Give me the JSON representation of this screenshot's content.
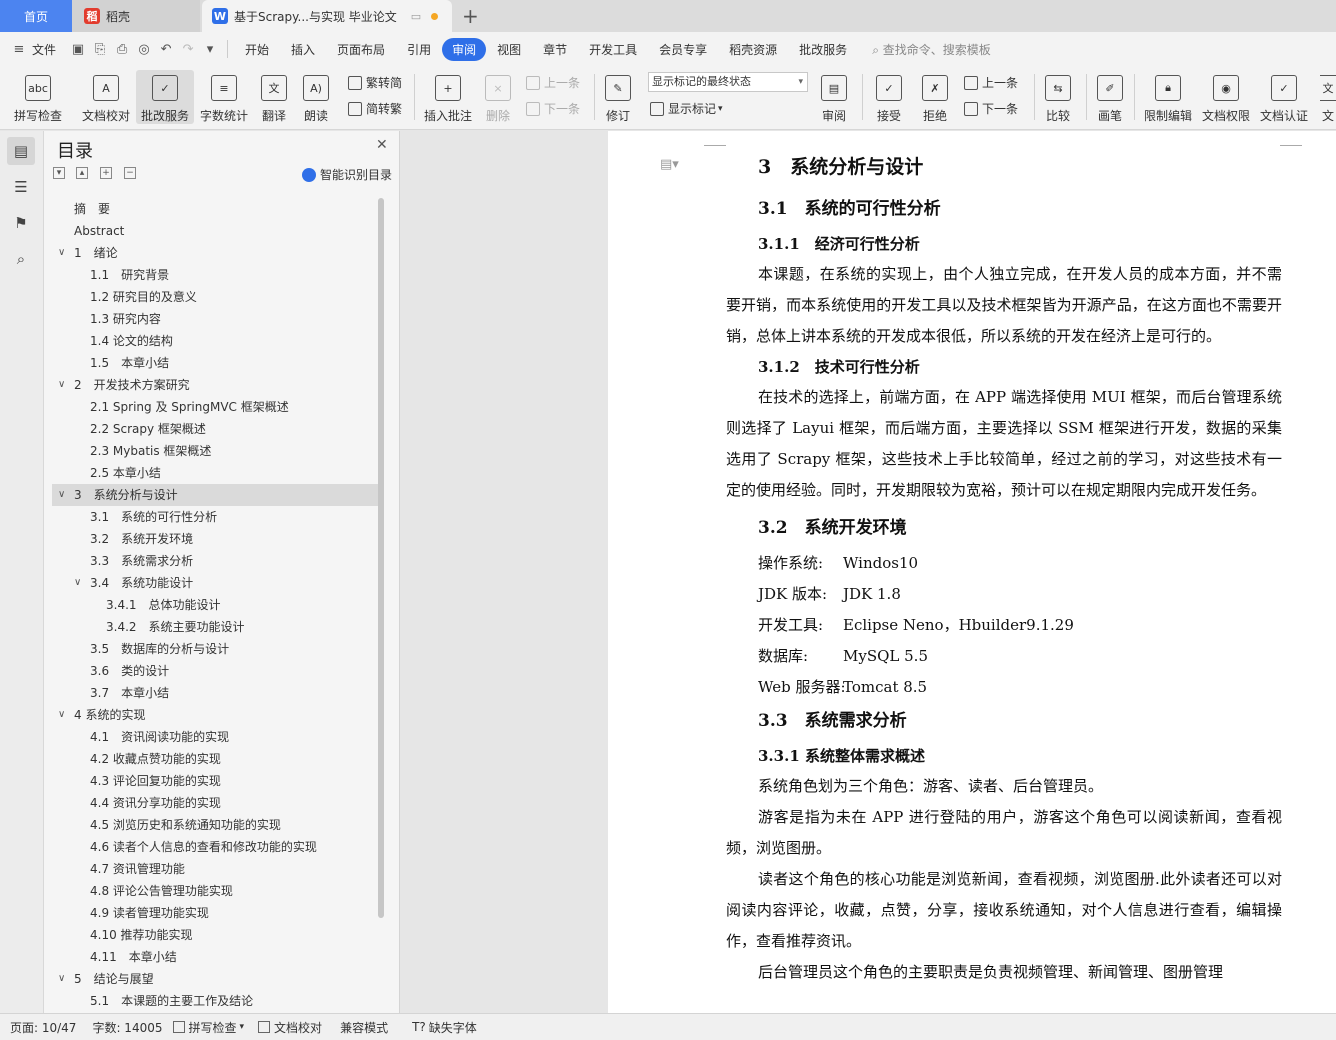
{
  "tabs": {
    "home": "首页",
    "daoke": "稻壳",
    "doc": "基于Scrapy...与实现 毕业论文"
  },
  "menu": [
    "文件",
    "开始",
    "插入",
    "页面布局",
    "引用",
    "审阅",
    "视图",
    "章节",
    "开发工具",
    "会员专享",
    "稻壳资源",
    "批改服务"
  ],
  "menu_active": "审阅",
  "menu_search": "查找命令、搜索模板",
  "ribbon": {
    "spell": "拼写检查",
    "proof": "文档校对",
    "correct": "批改服务",
    "wordcount": "字数统计",
    "translate": "翻译",
    "read": "朗读",
    "s2t": "繁转简",
    "t2s": "简转繁",
    "insert_comment": "插入批注",
    "delete": "删除",
    "prev_comment": "上一条",
    "next_comment": "下一条",
    "revise": "修订",
    "markup_state": "显示标记的最终状态",
    "show_markup": "显示标记",
    "review": "审阅",
    "accept": "接受",
    "reject": "拒绝",
    "prev_change": "上一条",
    "next_change": "下一条",
    "compare": "比较",
    "pen": "画笔",
    "restrict": "限制编辑",
    "permission": "文档权限",
    "certify": "文档认证",
    "more": "文"
  },
  "toc": {
    "title": "目录",
    "smart": "智能识别目录",
    "items": [
      {
        "text": "摘　要",
        "level": 0,
        "indent": 22
      },
      {
        "text": "Abstract",
        "level": 0,
        "indent": 22
      },
      {
        "text": "1　绪论",
        "level": 1,
        "indent": 22,
        "chev": true
      },
      {
        "text": "1.1　研究背景",
        "level": 2,
        "indent": 38
      },
      {
        "text": "1.2  研究目的及意义",
        "level": 2,
        "indent": 38
      },
      {
        "text": "1.3  研究内容",
        "level": 2,
        "indent": 38
      },
      {
        "text": "1.4  论文的结构",
        "level": 2,
        "indent": 38
      },
      {
        "text": "1.5　本章小结",
        "level": 2,
        "indent": 38
      },
      {
        "text": "2　开发技术方案研究",
        "level": 1,
        "indent": 22,
        "chev": true
      },
      {
        "text": "2.1 Spring 及 SpringMVC 框架概述",
        "level": 2,
        "indent": 38
      },
      {
        "text": "2.2 Scrapy 框架概述",
        "level": 2,
        "indent": 38
      },
      {
        "text": "2.3 Mybatis 框架概述",
        "level": 2,
        "indent": 38
      },
      {
        "text": "2.5  本章小结",
        "level": 2,
        "indent": 38
      },
      {
        "text": "3　系统分析与设计",
        "level": 1,
        "indent": 22,
        "chev": true,
        "selected": true
      },
      {
        "text": "3.1　系统的可行性分析",
        "level": 2,
        "indent": 38
      },
      {
        "text": "3.2　系统开发环境",
        "level": 2,
        "indent": 38
      },
      {
        "text": "3.3　系统需求分析",
        "level": 2,
        "indent": 38
      },
      {
        "text": "3.4　系统功能设计",
        "level": 2,
        "indent": 38,
        "chev": true
      },
      {
        "text": "3.4.1　总体功能设计",
        "level": 3,
        "indent": 54
      },
      {
        "text": "3.4.2　系统主要功能设计",
        "level": 3,
        "indent": 54
      },
      {
        "text": "3.5　数据库的分析与设计",
        "level": 2,
        "indent": 38
      },
      {
        "text": "3.6　类的设计",
        "level": 2,
        "indent": 38
      },
      {
        "text": "3.7　本章小结",
        "level": 2,
        "indent": 38
      },
      {
        "text": "4  系统的实现",
        "level": 1,
        "indent": 22,
        "chev": true
      },
      {
        "text": "4.1　资讯阅读功能的实现",
        "level": 2,
        "indent": 38
      },
      {
        "text": "4.2 收藏点赞功能的实现",
        "level": 2,
        "indent": 38
      },
      {
        "text": "4.3 评论回复功能的实现",
        "level": 2,
        "indent": 38
      },
      {
        "text": "4.4 资讯分享功能的实现",
        "level": 2,
        "indent": 38
      },
      {
        "text": "4.5 浏览历史和系统通知功能的实现",
        "level": 2,
        "indent": 38
      },
      {
        "text": "4.6 读者个人信息的查看和修改功能的实现",
        "level": 2,
        "indent": 38
      },
      {
        "text": "4.7 资讯管理功能",
        "level": 2,
        "indent": 38
      },
      {
        "text": "4.8 评论公告管理功能实现",
        "level": 2,
        "indent": 38
      },
      {
        "text": "4.9 读者管理功能实现",
        "level": 2,
        "indent": 38
      },
      {
        "text": "4.10 推荐功能实现",
        "level": 2,
        "indent": 38
      },
      {
        "text": "4.11　本章小结",
        "level": 2,
        "indent": 38
      },
      {
        "text": "5　结论与展望",
        "level": 1,
        "indent": 22,
        "chev": true
      },
      {
        "text": "5.1　本课题的主要工作及结论",
        "level": 2,
        "indent": 38
      }
    ]
  },
  "doc": {
    "h_3": "3　系统分析与设计",
    "h_3_1": "3.1　系统的可行性分析",
    "h_3_1_1": "3.1.1　经济可行性分析",
    "p_economic": "本课题，在系统的实现上，由个人独立完成，在开发人员的成本方面，并不需要开销，而本系统使用的开发工具以及技术框架皆为开源产品，在这方面也不需要开销，总体上讲本系统的开发成本很低，所以系统的开发在经济上是可行的。",
    "h_3_1_2": "3.1.2　技术可行性分析",
    "p_technical": "在技术的选择上，前端方面，在 APP 端选择使用 MUI 框架，而后台管理系统则选择了 Layui 框架，而后端方面，主要选择以 SSM 框架进行开发，数据的采集选用了 Scrapy 框架，这些技术上手比较简单，经过之前的学习，对这些技术有一定的使用经验。同时，开发期限较为宽裕，预计可以在规定期限内完成开发任务。",
    "h_3_2": "3.2　系统开发环境",
    "env": [
      {
        "k": "操作系统:",
        "v": "Windos10"
      },
      {
        "k": "JDK 版本:",
        "v": "JDK 1.8"
      },
      {
        "k": "开发工具:",
        "v": "Eclipse Neno，Hbuilder9.1.29"
      },
      {
        "k": "数据库:",
        "v": "MySQL 5.5"
      },
      {
        "k": "Web 服务器:",
        "v": "Tomcat 8.5"
      }
    ],
    "h_3_3": "3.3　系统需求分析",
    "h_3_3_1": "3.3.1  系统整体需求概述",
    "p_roles": "系统角色划为三个角色：游客、读者、后台管理员。",
    "p_guest": "游客是指为未在 APP 进行登陆的用户，游客这个角色可以阅读新闻，查看视频，浏览图册。",
    "p_reader": "读者这个角色的核心功能是浏览新闻，查看视频，浏览图册.此外读者还可以对阅读内容评论，收藏，点赞，分享，接收系统通知，对个人信息进行查看，编辑操作，查看推荐资讯。",
    "p_admin": "后台管理员这个角色的主要职责是负责视频管理、新闻管理、图册管理"
  },
  "status": {
    "page": "页面: 10/47",
    "words": "字数: 14005",
    "spell": "拼写检查",
    "proof": "文档校对",
    "compat": "兼容模式",
    "missing_font": "缺失字体"
  }
}
